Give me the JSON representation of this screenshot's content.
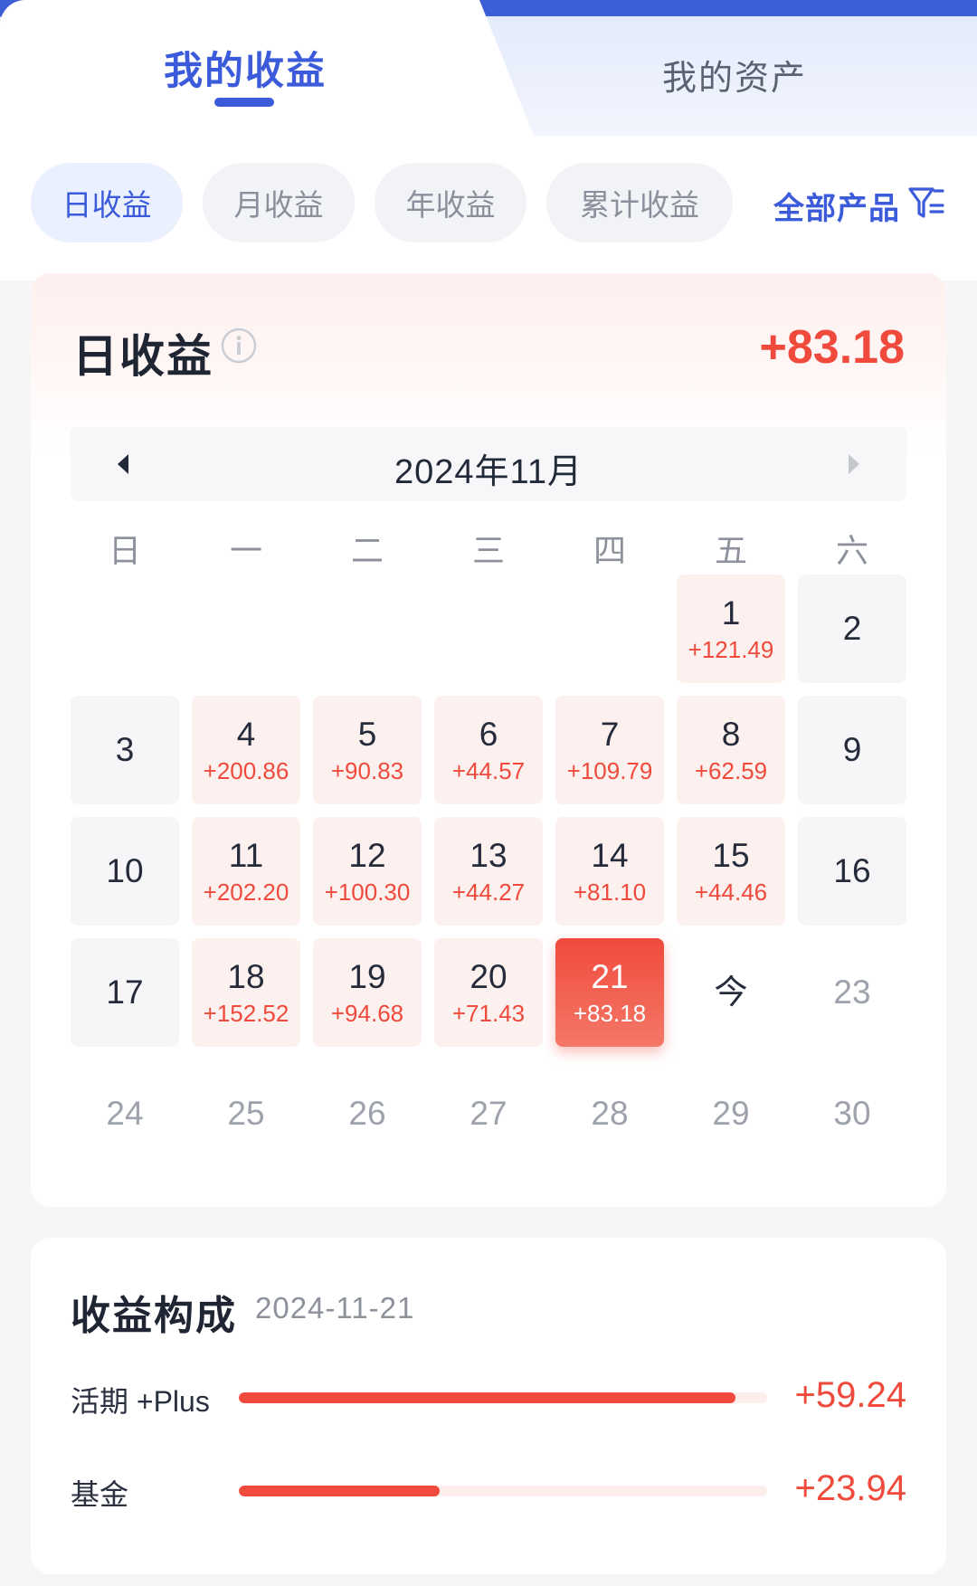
{
  "tabs": {
    "main": "我的收益",
    "secondary": "我的资产"
  },
  "filters": {
    "chips": [
      "日收益",
      "月收益",
      "年收益",
      "累计收益"
    ],
    "active_index": 0,
    "all_products": "全部产品"
  },
  "daily": {
    "title": "日收益",
    "total": "+83.18",
    "month": "2024年11月",
    "weekdays": [
      "日",
      "一",
      "二",
      "三",
      "四",
      "五",
      "六"
    ],
    "days": [
      {
        "n": "1",
        "v": "+121.49",
        "state": "gain"
      },
      {
        "n": "2",
        "v": "",
        "state": "plain"
      },
      {
        "n": "3",
        "v": "",
        "state": "plain"
      },
      {
        "n": "4",
        "v": "+200.86",
        "state": "gain"
      },
      {
        "n": "5",
        "v": "+90.83",
        "state": "gain"
      },
      {
        "n": "6",
        "v": "+44.57",
        "state": "gain"
      },
      {
        "n": "7",
        "v": "+109.79",
        "state": "gain"
      },
      {
        "n": "8",
        "v": "+62.59",
        "state": "gain"
      },
      {
        "n": "9",
        "v": "",
        "state": "plain"
      },
      {
        "n": "10",
        "v": "",
        "state": "plain"
      },
      {
        "n": "11",
        "v": "+202.20",
        "state": "gain"
      },
      {
        "n": "12",
        "v": "+100.30",
        "state": "gain"
      },
      {
        "n": "13",
        "v": "+44.27",
        "state": "gain"
      },
      {
        "n": "14",
        "v": "+81.10",
        "state": "gain"
      },
      {
        "n": "15",
        "v": "+44.46",
        "state": "gain"
      },
      {
        "n": "16",
        "v": "",
        "state": "plain"
      },
      {
        "n": "17",
        "v": "",
        "state": "plain"
      },
      {
        "n": "18",
        "v": "+152.52",
        "state": "gain"
      },
      {
        "n": "19",
        "v": "+94.68",
        "state": "gain"
      },
      {
        "n": "20",
        "v": "+71.43",
        "state": "gain"
      },
      {
        "n": "21",
        "v": "+83.18",
        "state": "selected"
      },
      {
        "n": "今",
        "v": "",
        "state": "today"
      },
      {
        "n": "23",
        "v": "",
        "state": "future"
      },
      {
        "n": "24",
        "v": "",
        "state": "future"
      },
      {
        "n": "25",
        "v": "",
        "state": "future"
      },
      {
        "n": "26",
        "v": "",
        "state": "future"
      },
      {
        "n": "27",
        "v": "",
        "state": "future"
      },
      {
        "n": "28",
        "v": "",
        "state": "future"
      },
      {
        "n": "29",
        "v": "",
        "state": "future"
      },
      {
        "n": "30",
        "v": "",
        "state": "future"
      }
    ],
    "first_weekday": 5
  },
  "composition": {
    "title": "收益构成",
    "date": "2024-11-21",
    "items": [
      {
        "label": "活期 +Plus",
        "value": "+59.24",
        "fraction": 0.94
      },
      {
        "label": "基金",
        "value": "+23.94",
        "fraction": 0.38
      }
    ]
  },
  "colors": {
    "accent": "#3b5bdb",
    "gain": "#ef4a3c"
  }
}
